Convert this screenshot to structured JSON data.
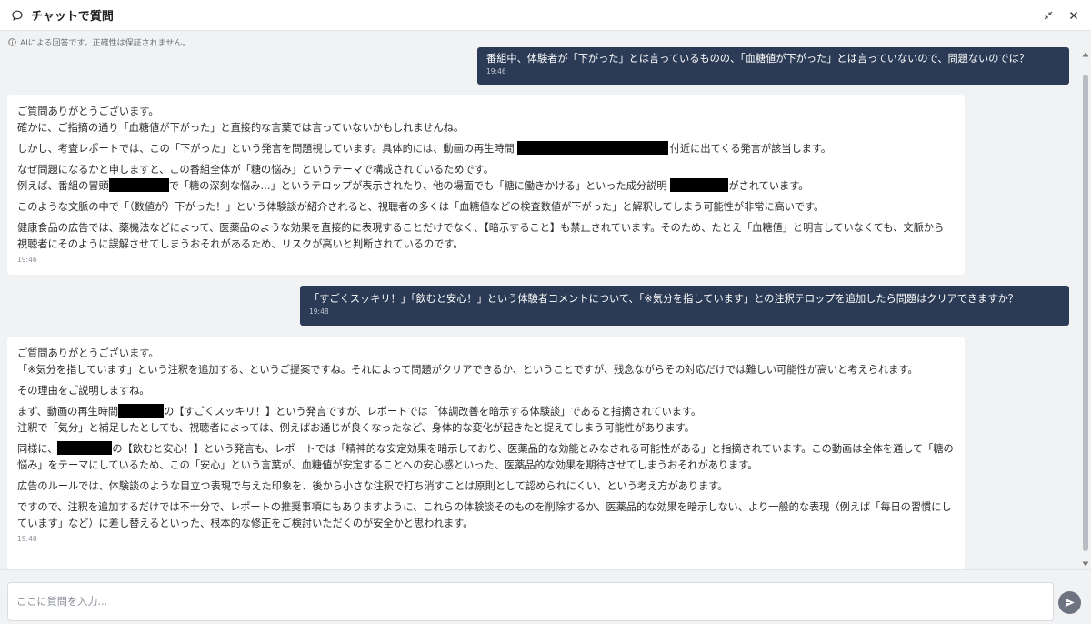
{
  "header": {
    "title": "チャットで質問",
    "icons": [
      "chat-bubble-icon",
      "collapse-icon",
      "close-icon"
    ]
  },
  "disclaimer": "AIによる回答です。正確性は保証されません。",
  "messages": [
    {
      "role": "user",
      "text": "番組中、体験者が「下がった」とは言っているものの、「血糖値が下がった」とは言っていないので、問題ないのでは？",
      "time": "19:46"
    },
    {
      "role": "assistant",
      "time": "19:46",
      "p1a": "ご質問ありがとうございます。",
      "p1b": "確かに、ご指摘の通り「血糖値が下がった」と直接的な言葉では言っていないかもしれませんね。",
      "p2a": "しかし、考査レポートでは、この「下がった」という発言を問題視しています。具体的には、動画の再生時間",
      "p2b": "付近に出てくる発言が該当します。",
      "p3a": "なぜ問題になるかと申しますと、この番組全体が「糖の悩み」というテーマで構成されているためです。",
      "p3b1": "例えば、番組の冒頭",
      "p3b2": "で「糖の深刻な悩み…」というテロップが表示されたり、他の場面でも「糖に働きかける」といった成分説明",
      "p3b3": "がされています。",
      "p4": "このような文脈の中で「（数値が）下がった！」という体験談が紹介されると、視聴者の多くは「血糖値などの検査数値が下がった」と解釈してしまう可能性が非常に高いです。",
      "p5": "健康食品の広告では、薬機法などによって、医薬品のような効果を直接的に表現することだけでなく、【暗示すること】も禁止されています。そのため、たとえ「血糖値」と明言していなくても、文脈から視聴者にそのように誤解させてしまうおそれがあるため、リスクが高いと判断されているのです。"
    },
    {
      "role": "user",
      "text": "「すごくスッキリ！」「飲むと安心！」という体験者コメントについて、「※気分を指しています」との注釈テロップを追加したら問題はクリアできますか？",
      "time": "19:48"
    },
    {
      "role": "assistant",
      "time": "19:48",
      "p1a": "ご質問ありがとうございます。",
      "p1b": "「※気分を指しています」という注釈を追加する、というご提案ですね。それによって問題がクリアできるか、ということですが、残念ながらその対応だけでは難しい可能性が高いと考えられます。",
      "p2": "その理由をご説明しますね。",
      "p3a1": "まず、動画の再生時間",
      "p3a2": "の【すごくスッキリ！】という発言ですが、レポートでは「体調改善を暗示する体験談」であると指摘されています。",
      "p3b": "注釈で「気分」と補足したとしても、視聴者によっては、例えばお通じが良くなったなど、身体的な変化が起きたと捉えてしまう可能性があります。",
      "p4a": "同様に、",
      "p4b": "の【飲むと安心！】という発言も、レポートでは「精神的な安定効果を暗示しており、医薬品的な効能とみなされる可能性がある」と指摘されています。この動画は全体を通して「糖の悩み」をテーマにしているため、この「安心」という言葉が、血糖値が安定することへの安心感といった、医薬品的な効果を期待させてしまうおそれがあります。",
      "p5": "広告のルールでは、体験談のような目立つ表現で与えた印象を、後から小さな注釈で打ち消すことは原則として認められにくい、という考え方があります。",
      "p6": "ですので、注釈を追加するだけでは不十分で、レポートの推奨事項にもありますように、これらの体験談そのものを削除するか、医薬品的な効果を暗示しない、より一般的な表現（例えば「毎日の習慣にしています」など）に差し替えるといった、根本的な修正をご検討いただくのが安全かと思われます。"
    }
  ],
  "composer": {
    "placeholder": "ここに質問を入力...",
    "value": ""
  },
  "colors": {
    "user_bubble": "#2b3a55",
    "assistant_bubble": "#ffffff",
    "background": "#f1f2f4",
    "send_button": "#6d7380"
  }
}
